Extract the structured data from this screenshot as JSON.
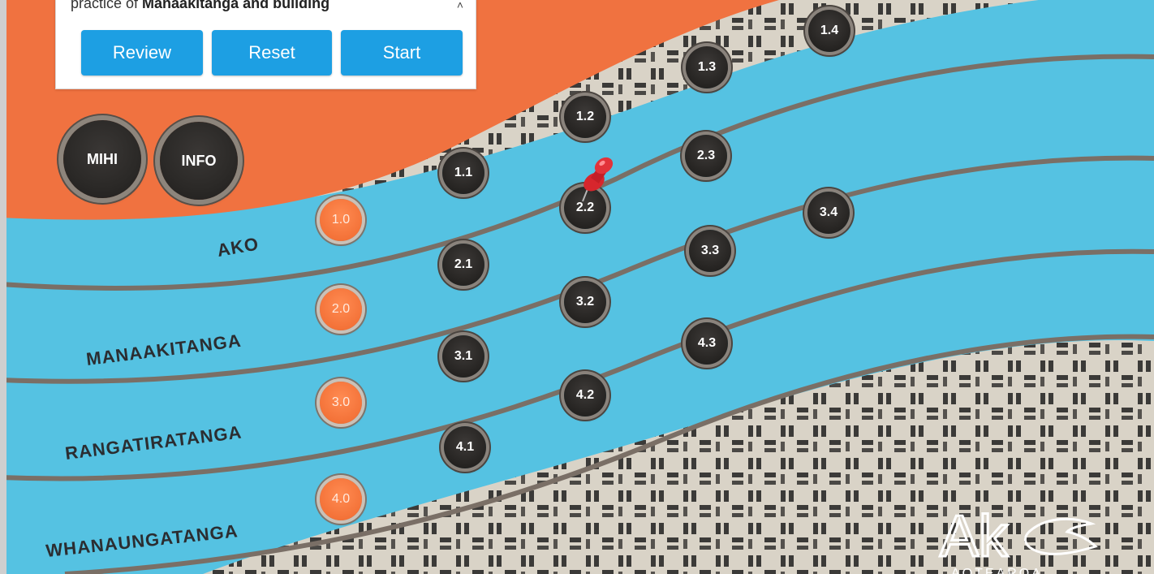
{
  "panel": {
    "desc_prefix": "practice of ",
    "desc_bold": "Manaakitanga and building",
    "scroll_arrow": "˄"
  },
  "buttons": {
    "review": "Review",
    "reset": "Reset",
    "start": "Start"
  },
  "round_buttons": {
    "mihi": "MIHI",
    "info": "INFO"
  },
  "rows": {
    "ako": "AKO",
    "manaakitanga": "MANAAKITANGA",
    "rangatiratanga": "RANGATIRATANGA",
    "whanaungatanga": "WHANAUNGATANGA"
  },
  "nodes": {
    "n1_0": "1.0",
    "n2_0": "2.0",
    "n3_0": "3.0",
    "n4_0": "4.0",
    "n1_1": "1.1",
    "n1_2": "1.2",
    "n1_3": "1.3",
    "n1_4": "1.4",
    "n2_1": "2.1",
    "n2_2": "2.2",
    "n2_3": "2.3",
    "n3_4": "3.4",
    "n3_1": "3.1",
    "n3_2": "3.2",
    "n3_3": "3.3",
    "n4_1": "4.1",
    "n4_2": "4.2",
    "n4_3": "4.3"
  },
  "logo": {
    "text": "AKO",
    "sub": "AOTEAROA"
  },
  "colors": {
    "orange": "#f07240",
    "blue": "#55c2e2",
    "button_blue": "#1d9fe3",
    "stripe_gray": "#7a6f66",
    "node_dark": "#252321"
  }
}
